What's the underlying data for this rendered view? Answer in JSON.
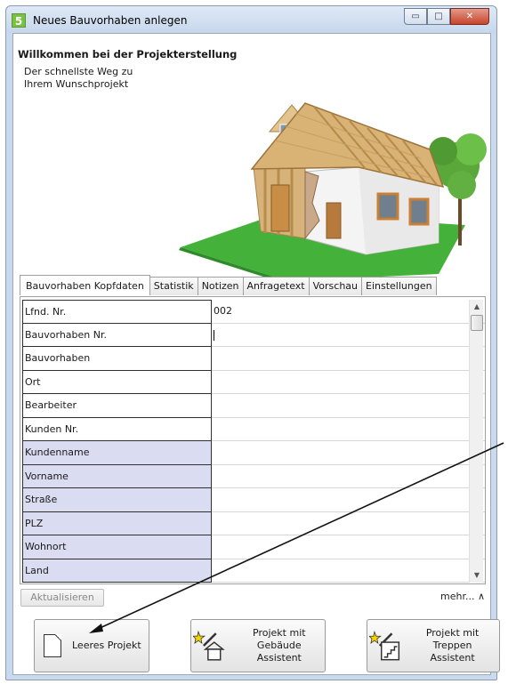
{
  "window": {
    "title": "Neues Bauvorhaben anlegen",
    "app_icon_letter": "5",
    "min_label": "▭",
    "max_label": "□",
    "close_label": "✕"
  },
  "header": {
    "title": "Willkommen bei der Projekterstellung",
    "subtitle": "Der schnellste Weg zu Ihrem Wunschprojekt"
  },
  "tabs": [
    {
      "label": "Bauvorhaben Kopfdaten",
      "active": true
    },
    {
      "label": "Statistik"
    },
    {
      "label": "Notizen"
    },
    {
      "label": "Anfragetext"
    },
    {
      "label": "Vorschau"
    },
    {
      "label": "Einstellungen"
    }
  ],
  "grid": {
    "rows": [
      {
        "label": "Lfnd. Nr.",
        "value": "002"
      },
      {
        "label": "Bauvorhaben Nr.",
        "value": ""
      },
      {
        "label": "Bauvorhaben",
        "value": ""
      },
      {
        "label": "Ort",
        "value": ""
      },
      {
        "label": "Bearbeiter",
        "value": ""
      },
      {
        "label": "Kunden Nr.",
        "value": ""
      },
      {
        "label": "Kundenname",
        "value": "",
        "highlight": true
      },
      {
        "label": "Vorname",
        "value": "",
        "highlight": true
      },
      {
        "label": "Straße",
        "value": "",
        "highlight": true
      },
      {
        "label": "PLZ",
        "value": "",
        "highlight": true
      },
      {
        "label": "Wohnort",
        "value": "",
        "highlight": true
      },
      {
        "label": "Land",
        "value": "",
        "highlight": true
      }
    ]
  },
  "actions": {
    "refresh_label": "Aktualisieren",
    "more_label": "mehr... ∧"
  },
  "buttons": {
    "empty_project": "Leeres Projekt",
    "building_wizard_line1": "Projekt mit",
    "building_wizard_line2": "Gebäude Assistent",
    "stairs_wizard_line1": "Projekt mit Treppen",
    "stairs_wizard_line2": "Assistent"
  },
  "colors": {
    "highlight_row": "#dadcf2",
    "accent_green": "#7cc242",
    "close_red": "#c8452a"
  }
}
